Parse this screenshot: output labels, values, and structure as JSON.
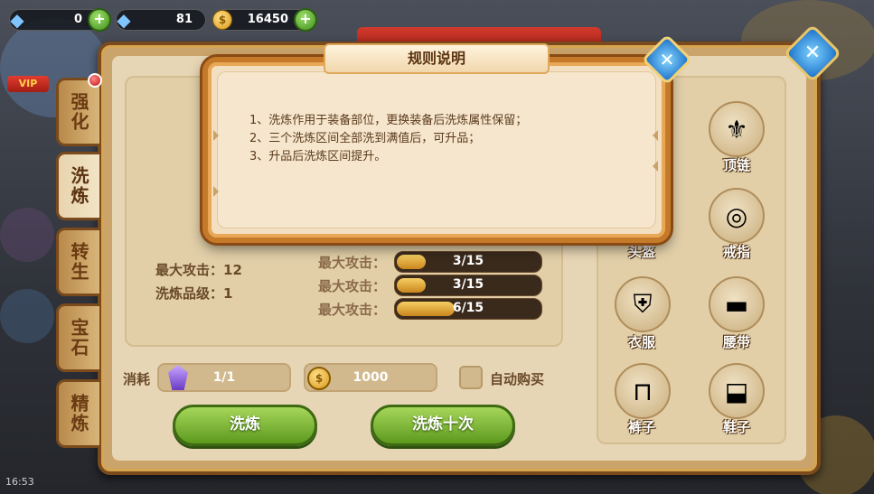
{
  "currency": {
    "gem_free": "0",
    "gem_locked": "81",
    "gold": "16450"
  },
  "vip_label": "VIP",
  "clock": "16:53",
  "tabs": [
    "强化",
    "洗炼",
    "转生",
    "宝石",
    "精炼"
  ],
  "active_tab": "洗炼",
  "stats": {
    "max_attack_label": "最大攻击：",
    "max_attack_value": "12",
    "grade_label": "洗炼品级：",
    "grade_value": "1"
  },
  "refine_bars": [
    {
      "label": "最大攻击：",
      "text": "3/15",
      "current": 3,
      "max": 15
    },
    {
      "label": "最大攻击：",
      "text": "3/15",
      "current": 3,
      "max": 15
    },
    {
      "label": "最大攻击：",
      "text": "6/15",
      "current": 6,
      "max": 15
    }
  ],
  "cost": {
    "label": "消耗",
    "crystal": "1/1",
    "gold": "1000",
    "auto_buy": "自动购买"
  },
  "buttons": {
    "refine": "洗炼",
    "refine_ten": "洗炼十次"
  },
  "equipment": [
    {
      "name": "顶链",
      "icon": "necklace-icon"
    },
    {
      "name": "头盔",
      "icon": "helmet-icon"
    },
    {
      "name": "戒指",
      "icon": "ring-icon"
    },
    {
      "name": "衣服",
      "icon": "armor-icon"
    },
    {
      "name": "腰带",
      "icon": "belt-icon"
    },
    {
      "name": "裤子",
      "icon": "pants-icon"
    },
    {
      "name": "鞋子",
      "icon": "boots-icon"
    }
  ],
  "modal": {
    "title": "规则说明",
    "rules": [
      "1、洗炼作用于装备部位，更换装备后洗炼属性保留；",
      "2、三个洗炼区间全部洗到满值后，可升品；",
      "3、升品后洗炼区间提升。"
    ]
  },
  "colors": {
    "panel": "#e7d6b5",
    "modal_border": "#c57a2a",
    "button_green": "#7ab83a",
    "bar_fill": "#e2a93a"
  }
}
